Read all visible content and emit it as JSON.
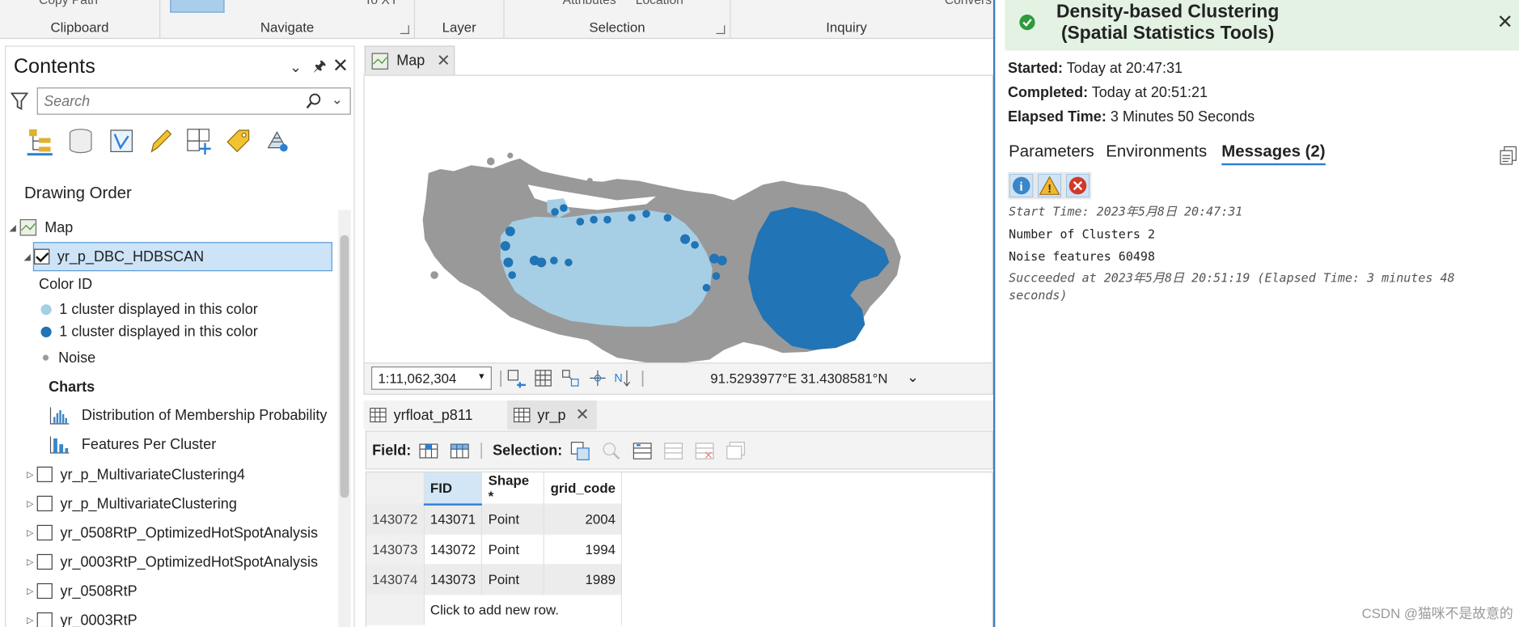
{
  "ribbon": {
    "top_items": [
      "Copy Path",
      "To XY",
      "Attributes",
      "Location",
      "Convers"
    ],
    "groups": [
      "Clipboard",
      "Navigate",
      "Layer",
      "Selection",
      "Inquiry"
    ]
  },
  "contents": {
    "title": "Contents",
    "search_placeholder": "Search",
    "drawing_order": "Drawing Order",
    "map_label": "Map",
    "selected_layer": "yr_p_DBC_HDBSCAN",
    "legend_heading": "Color ID",
    "legend": [
      {
        "label": "1 cluster displayed in this color",
        "color": "#a6cfe6"
      },
      {
        "label": "1 cluster displayed in this color",
        "color": "#2174b5"
      },
      {
        "label": "Noise",
        "color": "#9b9b9b"
      }
    ],
    "charts_heading": "Charts",
    "charts": [
      "Distribution of Membership Probability",
      "Features Per Cluster"
    ],
    "layers": [
      "yr_p_MultivariateClustering4",
      "yr_p_MultivariateClustering",
      "yr_0508RtP_OptimizedHotSpotAnalysis",
      "yr_0003RtP_OptimizedHotSpotAnalysis",
      "yr_0508RtP",
      "yr_0003RtP"
    ]
  },
  "map": {
    "tab_label": "Map",
    "scale": "1:11,062,304",
    "coordinates": "91.5293977°E 31.4308581°N",
    "colors": {
      "noise": "#999999",
      "cluster_light": "#a6cfe6",
      "cluster_dark": "#2174b5"
    }
  },
  "table": {
    "tabs": [
      "yrfloat_p811",
      "yr_p"
    ],
    "field_label": "Field:",
    "selection_label": "Selection:",
    "columns": [
      "FID",
      "Shape *",
      "grid_code"
    ],
    "rows": [
      {
        "id": "143072",
        "fid": "143071",
        "shape": "Point",
        "grid_code": "2004"
      },
      {
        "id": "143073",
        "fid": "143072",
        "shape": "Point",
        "grid_code": "1994"
      },
      {
        "id": "143074",
        "fid": "143073",
        "shape": "Point",
        "grid_code": "1989"
      }
    ],
    "add_row_text": "Click to add new row."
  },
  "messages": {
    "title_line1": "Density-based Clustering",
    "title_line2": "(Spatial Statistics Tools)",
    "started_label": "Started:",
    "started": "Today at 20:47:31",
    "completed_label": "Completed:",
    "completed": "Today at 20:51:21",
    "elapsed_label": "Elapsed Time:",
    "elapsed": "3 Minutes 50 Seconds",
    "tabs": [
      "Parameters",
      "Environments",
      "Messages (2)"
    ],
    "lines": [
      "Start Time: 2023年5月8日 20:47:31",
      "Number of Clusters 2",
      "Noise features 60498",
      "Succeeded at 2023年5月8日 20:51:19 (Elapsed Time: 3 minutes 48",
      "seconds)"
    ]
  },
  "watermark": "CSDN @猫咪不是故意的"
}
